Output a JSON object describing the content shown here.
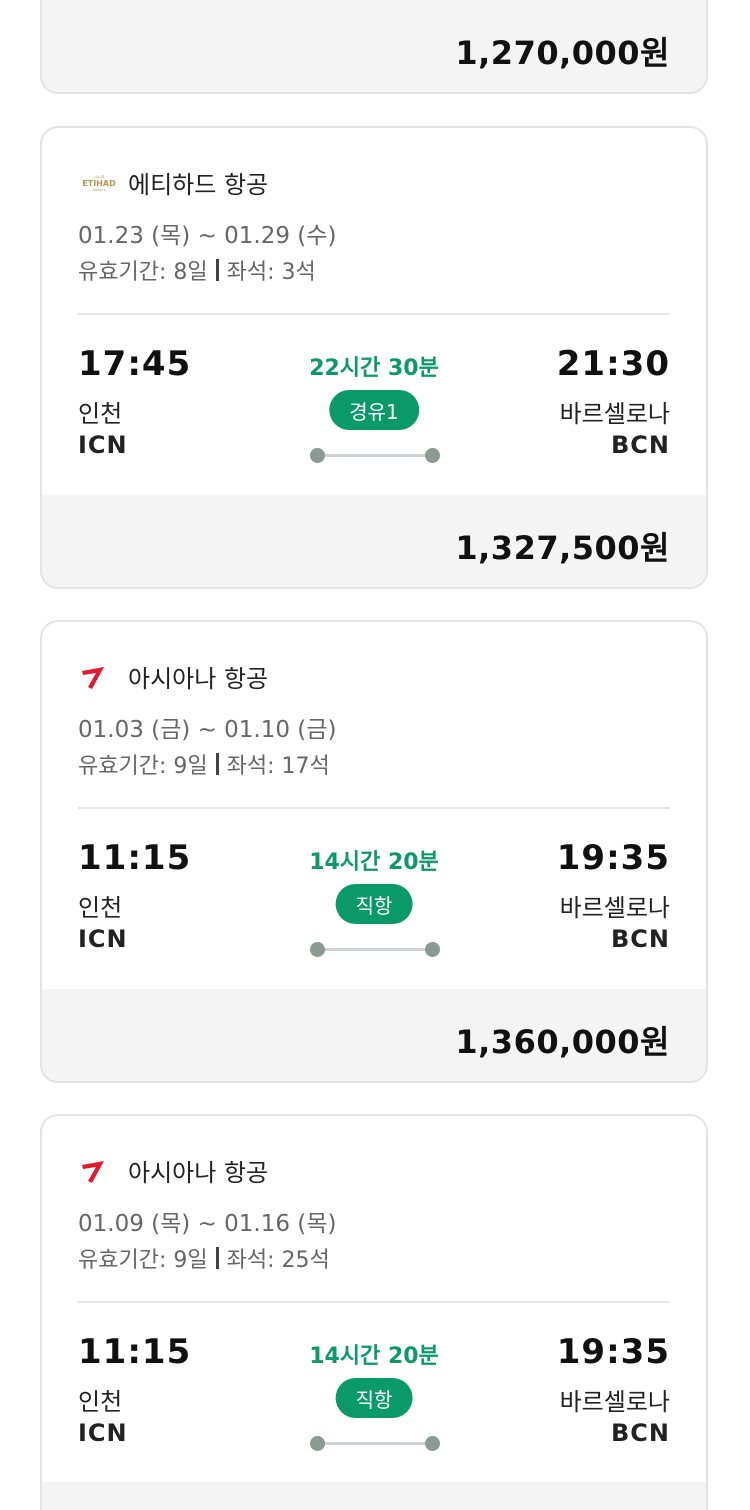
{
  "top_card": {
    "price": "1,270,000원"
  },
  "cards": [
    {
      "airline": "에티하드 항공",
      "logo_icon": "etihad-logo",
      "logo_text": "ETIHAD",
      "dates": "01.23 (목) ~ 01.29 (수)",
      "validity": "유효기간: 8일",
      "seats": "좌석: 3석",
      "dep_time": "17:45",
      "dep_city": "인천",
      "dep_code": "ICN",
      "duration": "22시간 30분",
      "stop": "경유1",
      "arr_time": "21:30",
      "arr_city": "바르셀로나",
      "arr_code": "BCN",
      "price": "1,327,500원"
    },
    {
      "airline": "아시아나 항공",
      "logo_icon": "asiana-logo",
      "dates": "01.03 (금) ~ 01.10 (금)",
      "validity": "유효기간: 9일",
      "seats": "좌석: 17석",
      "dep_time": "11:15",
      "dep_city": "인천",
      "dep_code": "ICN",
      "duration": "14시간 20분",
      "stop": "직항",
      "arr_time": "19:35",
      "arr_city": "바르셀로나",
      "arr_code": "BCN",
      "price": "1,360,000원"
    },
    {
      "airline": "아시아나 항공",
      "logo_icon": "asiana-logo",
      "dates": "01.09 (목) ~ 01.16 (목)",
      "validity": "유효기간: 9일",
      "seats": "좌석: 25석",
      "dep_time": "11:15",
      "dep_city": "인천",
      "dep_code": "ICN",
      "duration": "14시간 20분",
      "stop": "직항",
      "arr_time": "19:35",
      "arr_city": "바르셀로나",
      "arr_code": "BCN"
    }
  ],
  "colors": {
    "accent_green": "#0a9a6a",
    "price_bg": "#f4f4f4",
    "asiana_red": "#e21b2c",
    "etihad_gold": "#b8935a"
  }
}
